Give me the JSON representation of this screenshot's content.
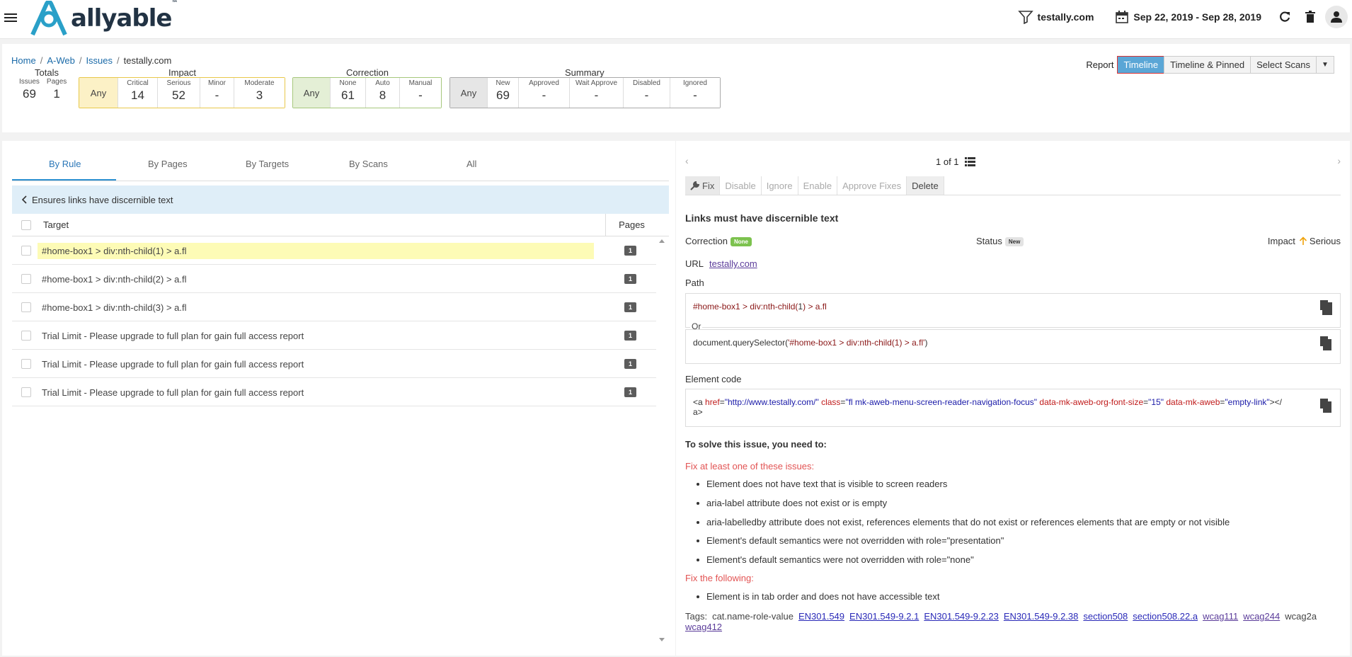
{
  "app": {
    "logo_text": "allyable",
    "logo_tm": "™"
  },
  "topbar": {
    "site": "testally.com",
    "date_range": "Sep 22, 2019 - Sep 28, 2019"
  },
  "breadcrumb": {
    "home": "Home",
    "aweb": "A-Web",
    "issues": "Issues",
    "current": "testally.com",
    "sep": "/"
  },
  "report": {
    "label": "Report",
    "timeline": "Timeline",
    "timeline_pinned": "Timeline & Pinned",
    "select_scans": "Select Scans",
    "caret": "▼"
  },
  "totals": {
    "title": "Totals",
    "issues_label": "Issues",
    "issues": "69",
    "pages_label": "Pages",
    "pages": "1"
  },
  "impact": {
    "title": "Impact",
    "any": "Any",
    "critical_label": "Critical",
    "critical": "14",
    "serious_label": "Serious",
    "serious": "52",
    "minor_label": "Minor",
    "minor": "-",
    "moderate_label": "Moderate",
    "moderate": "3"
  },
  "correction": {
    "title": "Correction",
    "any": "Any",
    "none_label": "None",
    "none": "61",
    "auto_label": "Auto",
    "auto": "8",
    "manual_label": "Manual",
    "manual": "-"
  },
  "summary": {
    "title": "Summary",
    "any": "Any",
    "new_label": "New",
    "new": "69",
    "approved_label": "Approved",
    "approved": "-",
    "wait_label": "Wait Approve",
    "wait": "-",
    "disabled_label": "Disabled",
    "disabled": "-",
    "ignored_label": "Ignored",
    "ignored": "-"
  },
  "tabs": {
    "by_rule": "By Rule",
    "by_pages": "By Pages",
    "by_targets": "By Targets",
    "by_scans": "By Scans",
    "all": "All"
  },
  "rule": {
    "title": "Ensures links have discernible text"
  },
  "table": {
    "col_target": "Target",
    "col_pages": "Pages",
    "rows": [
      {
        "target": "#home-box1 > div:nth-child(1) > a.fl",
        "pages": "1"
      },
      {
        "target": "#home-box1 > div:nth-child(2) > a.fl",
        "pages": "1"
      },
      {
        "target": "#home-box1 > div:nth-child(3) > a.fl",
        "pages": "1"
      },
      {
        "target": "Trial Limit - Please upgrade to full plan for gain full access report",
        "pages": "1"
      },
      {
        "target": "Trial Limit - Please upgrade to full plan for gain full access report",
        "pages": "1"
      },
      {
        "target": "Trial Limit - Please upgrade to full plan for gain full access report",
        "pages": "1"
      }
    ]
  },
  "detail": {
    "pager": "1 of 1",
    "actions": {
      "fix": "Fix",
      "disable": "Disable",
      "ignore": "Ignore",
      "enable": "Enable",
      "approve": "Approve Fixes",
      "delete": "Delete"
    },
    "title": "Links must have discernible text",
    "correction_label": "Correction",
    "correction_value": "None",
    "status_label": "Status",
    "status_value": "New",
    "impact_label": "Impact",
    "impact_value": "Serious",
    "url_label": "URL",
    "url": "testally.com",
    "path_label": "Path",
    "path_sel_1": "#home-box1 > div:nth-child(",
    "path_num": "1",
    "path_sel_2": ") > a.fl",
    "or_label": "Or",
    "qs_fn": "document.querySelector(",
    "qs_arg": "'#home-box1 > div:nth-child(1) > a.fl'",
    "qs_close": ")",
    "element_code_label": "Element code",
    "code": {
      "open": "<a ",
      "attr1": "href",
      "eq1": "=",
      "val1": "\"http://www.testally.com/\"",
      "attr2": "class",
      "eq2": "=",
      "val2": "\"fl mk-aweb-menu-screen-reader-navigation-focus\"",
      "attr3": "data-mk-aweb-org-font-size",
      "eq3": "=",
      "val3": "\"15\"",
      "attr4": "data-mk-aweb",
      "eq4": "=",
      "val4": "\"empty-link\"",
      "close1": "></",
      "close2": "a>"
    },
    "solve_label": "To solve this issue, you need to:",
    "fix_one_label": "Fix at least one of these issues:",
    "fix_one": [
      "Element does not have text that is visible to screen readers",
      "aria-label attribute does not exist or is empty",
      "aria-labelledby attribute does not exist, references elements that do not exist or references elements that are empty or not visible",
      "Element's default semantics were not overridden with role=\"presentation\"",
      "Element's default semantics were not overridden with role=\"none\""
    ],
    "fix_following_label": "Fix the following:",
    "fix_following": [
      "Element is in tab order and does not have accessible text"
    ],
    "tags_label": "Tags:",
    "tags_plain_1": "cat.name-role-value",
    "tags": [
      "EN301.549",
      "EN301.549-9.2.1",
      "EN301.549-9.2.23",
      "EN301.549-9.2.38",
      "section508",
      "section508.22.a",
      "wcag111",
      "wcag244"
    ],
    "tags_plain_2": "wcag2a",
    "tags_last": "wcag412"
  },
  "colors": {
    "accent": "#5aa6d6",
    "link": "#1a6aa8",
    "alert": "#e25353",
    "highlight": "#fdfbb6",
    "rule_bar": "#dfeef8"
  },
  "icons": [
    "menu-icon",
    "logo-a-icon",
    "funnel-icon",
    "calendar-icon",
    "refresh-icon",
    "trash-icon",
    "user-icon",
    "chevron-left-icon",
    "list-icon",
    "chevron-right-icon",
    "wrench-icon",
    "copy-icon",
    "arrow-up-icon"
  ]
}
